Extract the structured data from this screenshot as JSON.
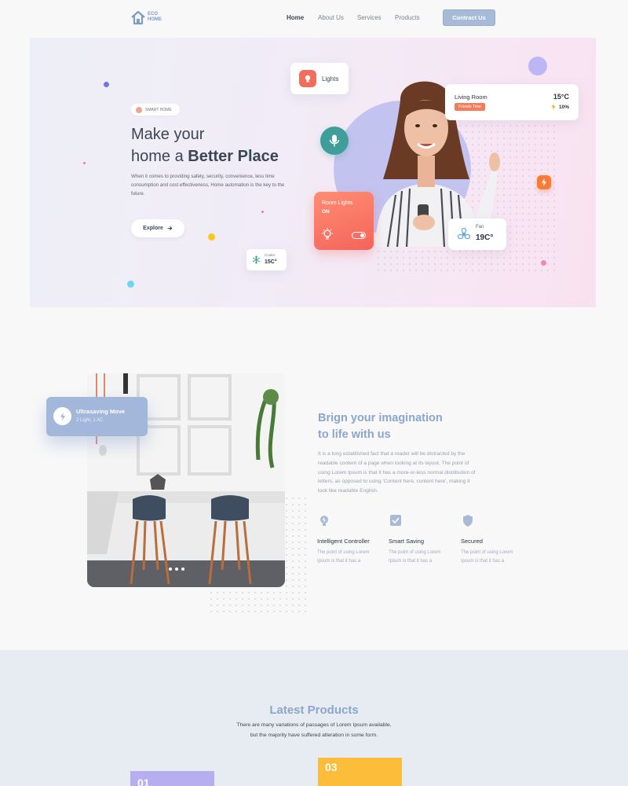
{
  "nav": {
    "logo_line1": "ECO",
    "logo_line2": "HOME",
    "links": [
      "Home",
      "About Us",
      "Services",
      "Products"
    ],
    "active": "Home",
    "cta": "Contract Us"
  },
  "hero": {
    "badge": "SMART HOME",
    "title_line1": "Make your",
    "title_line2_prefix": "home a ",
    "title_line2_bold": "Better Place",
    "description": "When it comes to providing safety, security, convenience, less time consumption and cost effectiveness, Home automation is the key to the future.",
    "explore": "Explore",
    "lights_label": "Lights",
    "living": {
      "title": "Living Room",
      "tag": "Friends Time",
      "temp": "15°C",
      "percent": "10%"
    },
    "room_lights": {
      "title": "Room Lights",
      "state": "ON"
    },
    "fan": {
      "label": "Fan",
      "temp": "19C°"
    },
    "cooler": {
      "label": "Cooler",
      "temp": "15C°"
    }
  },
  "section2": {
    "ultra": {
      "title": "Ultrasaving Move",
      "sub": "2 Light, 1 AC"
    },
    "title_line1": "Brign your imagination",
    "title_line2": "to life with us",
    "paragraph": "It is a long established fact that a reader will be distracted by the readable content of a page when looking at its layout. The point of using Lorem Ipsum is that it has a more-or-less normal distribution of letters, as opposed to using 'Content here, content here', making it look like readable English.",
    "features": [
      {
        "title": "Intelligent Controller",
        "text": "The point of using Lorem Ipsum is that it has a",
        "icon": "bulb-icon"
      },
      {
        "title": "Smart Saving",
        "text": "The point of using Lorem Ipsum is that it has a",
        "icon": "check-icon"
      },
      {
        "title": "Secured",
        "text": "The point of using Lorem Ipsum is that it has a",
        "icon": "shield-icon"
      }
    ]
  },
  "latest": {
    "title": "Latest Products",
    "line1": "There are many variations of passages of Lorem Ipsum available,",
    "line2": "but the majority have suffered alteration in some form.",
    "products": [
      {
        "num": "01",
        "color": "#b7aef0"
      },
      {
        "num": "03",
        "color": "#fbbd3a"
      }
    ]
  },
  "colors": {
    "accent": "#8aa6cc",
    "coral": "#f4645a",
    "teal": "#3f9e9a",
    "orange": "#fb7a36"
  }
}
